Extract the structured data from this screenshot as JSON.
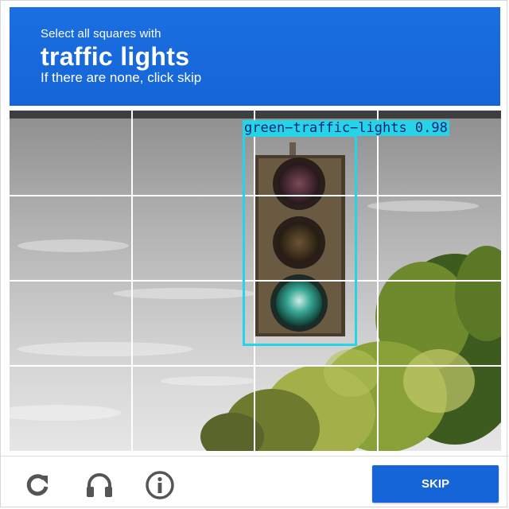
{
  "header": {
    "instruction": "Select all squares with",
    "target": "traffic lights",
    "hint": "If there are none, click skip"
  },
  "detection": {
    "label": "green−traffic−lights 0.98"
  },
  "grid": {
    "rows": 4,
    "cols": 4
  },
  "footer": {
    "reload_icon": "reload-icon",
    "audio_icon": "headphones-icon",
    "info_icon": "info-icon",
    "skip_label": "SKIP"
  },
  "colors": {
    "accent": "#1565d8",
    "detection": "#25d4e6"
  }
}
